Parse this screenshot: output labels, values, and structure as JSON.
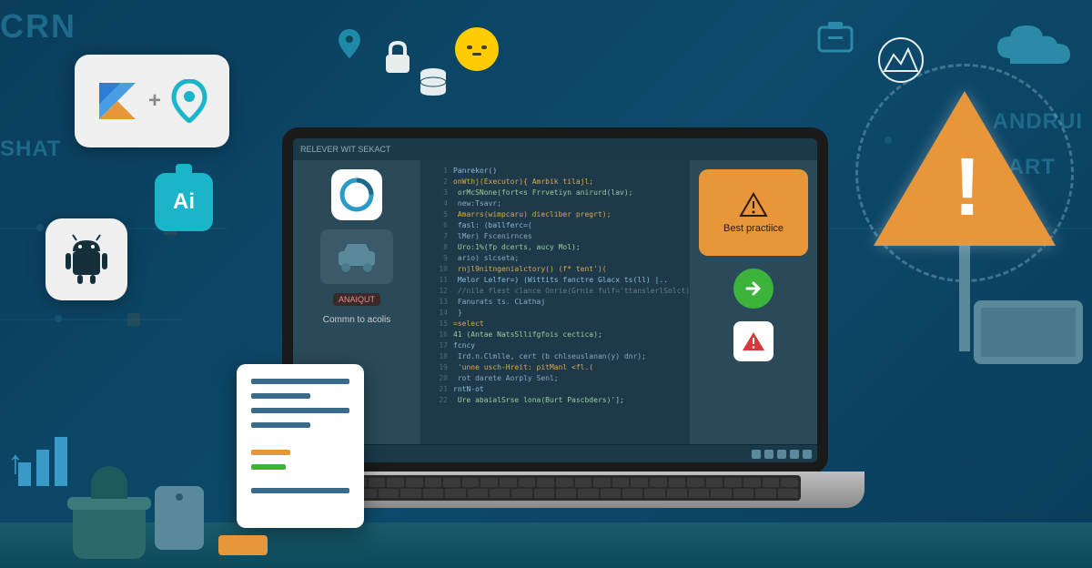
{
  "corner_text": "CRN",
  "left_text_1": "SHAT",
  "right_text_1": "ANDRUI",
  "right_text_2": "ART",
  "ai_label": "Ai",
  "screen": {
    "title": "RELEVER WIT SEKACT",
    "sidebar_tag": "ANAIQUT",
    "sidebar_label": "Commn to acolis"
  },
  "warning_card": {
    "label": "Best practiice"
  },
  "code": {
    "lines": [
      {
        "n": "1",
        "t": "Panrekor()"
      },
      {
        "n": "2",
        "t": "onWthj(Executor){ Amrbik tilajl;"
      },
      {
        "n": "3",
        "t": "  orMcSNone(fort<s Frrvetiyn anirurd(lav);"
      },
      {
        "n": "4",
        "t": "  new:Tsavr;"
      },
      {
        "n": "5",
        "t": "  Amarrs(wimpcaru) diecliber pregrt);"
      },
      {
        "n": "6",
        "t": "  fasl: (ballferc=("
      },
      {
        "n": "7",
        "t": "     lMer) Fscenirnces"
      },
      {
        "n": "8",
        "t": "     Uro:1%(fp dcerts, aucy Mol);"
      },
      {
        "n": "9",
        "t": "     ario) slcseta;"
      },
      {
        "n": "10",
        "t": "     rnjl9nitngenialctory() (f* tent')("
      },
      {
        "n": "11",
        "t": "     Melor Lelfer=) (Wittits fanctre Glacx ts(ll) |.."
      },
      {
        "n": "12",
        "t": "     //nile flest clance Onrie(Grnie fulf='ttanslerlSolct);"
      },
      {
        "n": "13",
        "t": "     Fanurats ts. CLathaj"
      },
      {
        "n": "14",
        "t": "  }"
      },
      {
        "n": "15",
        "t": "=select"
      },
      {
        "n": "16",
        "t": "41 (Antae NatsSllifgfois cectica);"
      },
      {
        "n": "17",
        "t": "fcncy"
      },
      {
        "n": "18",
        "t": "  Ird.n.Clmlle, cert (b chlseuslanan(y) dnr);"
      },
      {
        "n": "19",
        "t": "  'unne usch-Hreit: pitManl <fl.("
      },
      {
        "n": "20",
        "t": "  rot darete Aorply Senl;"
      },
      {
        "n": "21",
        "t": "rntN-ot"
      },
      {
        "n": "22",
        "t": "  Ure abaialSrse lona(Burt Pascbders)'];"
      }
    ]
  }
}
